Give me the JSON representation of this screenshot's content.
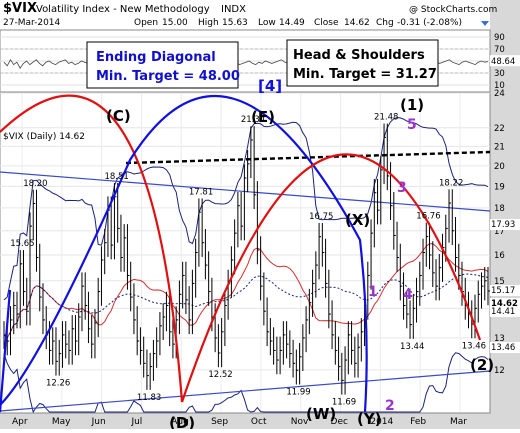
{
  "header": {
    "symbol": "$VIX",
    "name": "Volatility Index - New Methodology",
    "exchange": "INDX",
    "watermark": "@ StockCharts.com",
    "date": "27-Mar-2014",
    "open_label": "Open",
    "open": "15.00",
    "high_label": "High",
    "high": "15.63",
    "low_label": "Low",
    "low": "14.49",
    "close_label": "Close",
    "close": "14.62",
    "chg_label": "Chg",
    "chg": "-0.31 (-2.08%)"
  },
  "colors": {
    "price": "#000000",
    "bb": "#1a237e",
    "ma": "#d32f2f",
    "trend": "#3a4bc4",
    "red_arc": "#e01010",
    "blue_arc": "#1010e0",
    "axis_bg": "#d8d8d8",
    "box_blue_text": "#1010cc",
    "purple": "#9933cc"
  },
  "indicator": {
    "ticks": [
      "90",
      "70",
      "50",
      "30",
      "10"
    ],
    "value_labels": [
      "48.64"
    ],
    "values": [
      48,
      42,
      52,
      44,
      48,
      38,
      46,
      50,
      44,
      48,
      52,
      46,
      42,
      48,
      50,
      46,
      44,
      48,
      50,
      52,
      46,
      48,
      44,
      46,
      50,
      48,
      46,
      44,
      48,
      50,
      52,
      48,
      46,
      44,
      50,
      48,
      46,
      44,
      48,
      52,
      50,
      48,
      46,
      44,
      48,
      50,
      48,
      46,
      44,
      48,
      46,
      48,
      50,
      52,
      48,
      46,
      44,
      48,
      50,
      46,
      44,
      48,
      46,
      50,
      52,
      48,
      46,
      44,
      48,
      50,
      48,
      46,
      48,
      44,
      46,
      48,
      50,
      46,
      44,
      48,
      46,
      50,
      48,
      46,
      48,
      50,
      52,
      48,
      46,
      44,
      48,
      50,
      48,
      46,
      44,
      48,
      46,
      50,
      48,
      46,
      48,
      50,
      44,
      46,
      48,
      50,
      46,
      44,
      48,
      50,
      48,
      46,
      44,
      48,
      50,
      48,
      46,
      44,
      48,
      50,
      48,
      46,
      44,
      48,
      50,
      46,
      44,
      48,
      50,
      48,
      46,
      44,
      48,
      50,
      48,
      46,
      48,
      50,
      52,
      48,
      46,
      44,
      48,
      50,
      48,
      46,
      44,
      48,
      50,
      48,
      49
    ]
  },
  "boxes": {
    "ending_diagonal_line1": "Ending Diagonal",
    "ending_diagonal_line2": "Min. Target = 48.00",
    "hs_line1": "Head & Shoulders",
    "hs_line2": "Min. Target = 31.27"
  },
  "annotations": {
    "wave4": "[4]",
    "wave1": "(1)",
    "waveC": "(C)",
    "waveE": "(E)",
    "waveX_top": "(X)",
    "waveD": "(D)",
    "waveW": "(W)",
    "waveY": "(Y)",
    "wave2": "(2)",
    "sub1": "1",
    "sub2": "2",
    "sub3": "3",
    "sub4": "4",
    "sub5": "5"
  },
  "legend": {
    "main": "$VIX (Daily) 14.62"
  },
  "chart_data": {
    "type": "line",
    "title": "$VIX Volatility Index - New Methodology INDX",
    "xlabel": "",
    "ylabel": "",
    "ylim": [
      10.8,
      24.0
    ],
    "y_scale": "log",
    "y_ticks": [
      12,
      13,
      14,
      15,
      16,
      17,
      18,
      19,
      20,
      21,
      22,
      24
    ],
    "x_ticks": [
      "Apr",
      "May",
      "Jun",
      "Jul",
      "Aug",
      "Sep",
      "Oct",
      "Nov",
      "Dec",
      "2014",
      "Feb",
      "Mar"
    ],
    "last_values": [
      "15.17",
      "14.62",
      "14.41",
      "13.46",
      "17.93"
    ],
    "price_labels": [
      {
        "text": "18.20",
        "value": 18.2
      },
      {
        "text": "15.65",
        "value": 15.65
      },
      {
        "text": "12.26",
        "value": 12.26
      },
      {
        "text": "18.51",
        "value": 18.51
      },
      {
        "text": "11.83",
        "value": 11.83
      },
      {
        "text": "17.81",
        "value": 17.81
      },
      {
        "text": "12.52",
        "value": 12.52
      },
      {
        "text": "21.34",
        "value": 21.34
      },
      {
        "text": "11.99",
        "value": 11.99
      },
      {
        "text": "16.75",
        "value": 16.75
      },
      {
        "text": "11.69",
        "value": 11.69
      },
      {
        "text": "21.48",
        "value": 21.48
      },
      {
        "text": "13.44",
        "value": 13.44
      },
      {
        "text": "16.76",
        "value": 16.76
      },
      {
        "text": "18.22",
        "value": 18.22
      },
      {
        "text": "13.46",
        "value": 13.46
      }
    ],
    "series": [
      {
        "name": "$VIX (Daily)",
        "values": [
          13.1,
          12.9,
          13.6,
          14.1,
          13.8,
          15.65,
          14.6,
          13.9,
          17.2,
          18.2,
          15.9,
          14.4,
          13.6,
          13.1,
          12.6,
          12.9,
          12.26,
          12.5,
          13.1,
          12.8,
          12.6,
          13.3,
          12.9,
          13.7,
          14.8,
          14.1,
          13.3,
          12.8,
          13.5,
          14.6,
          15.8,
          16.5,
          17.9,
          16.4,
          18.51,
          17.1,
          15.9,
          16.7,
          15.2,
          14.4,
          13.6,
          12.9,
          12.6,
          12.2,
          11.83,
          12.1,
          12.5,
          12.9,
          13.4,
          13.7,
          14.1,
          13.2,
          12.8,
          13.6,
          14.5,
          15.2,
          14.3,
          13.6,
          14.9,
          16.1,
          17.81,
          16.5,
          15.6,
          14.6,
          13.7,
          13.0,
          12.52,
          13.2,
          14.1,
          14.9,
          15.8,
          16.9,
          18.1,
          17.2,
          19.4,
          20.1,
          21.34,
          18.6,
          16.2,
          14.8,
          13.9,
          13.2,
          12.9,
          12.6,
          12.3,
          12.6,
          13.1,
          12.8,
          12.5,
          12.2,
          11.99,
          12.4,
          13.0,
          13.6,
          14.2,
          14.9,
          15.6,
          16.75,
          16.1,
          14.9,
          13.8,
          13.1,
          12.6,
          12.1,
          11.69,
          12.3,
          13.1,
          12.6,
          12.2,
          12.7,
          13.2,
          14.1,
          15.2,
          16.9,
          18.7,
          17.9,
          19.8,
          21.48,
          19.5,
          18.1,
          16.8,
          15.9,
          14.8,
          14.1,
          13.8,
          13.44,
          14.0,
          14.6,
          15.2,
          16.1,
          16.76,
          16.0,
          15.3,
          14.8,
          15.5,
          16.3,
          17.1,
          18.22,
          17.0,
          15.9,
          15.2,
          14.6,
          14.1,
          13.8,
          13.46,
          14.0,
          14.5,
          14.8,
          15.0,
          14.62
        ]
      }
    ]
  }
}
